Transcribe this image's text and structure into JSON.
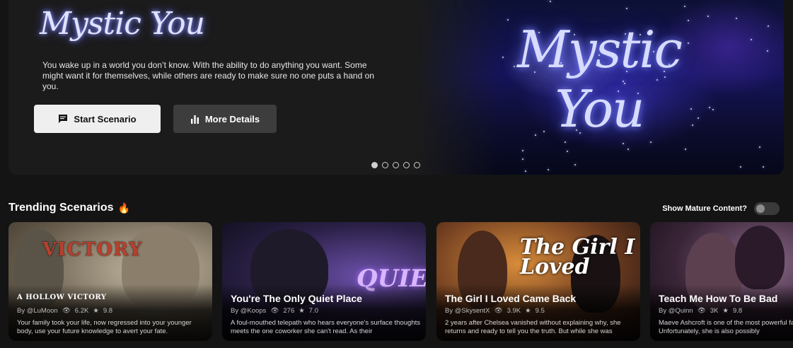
{
  "hero": {
    "logo_text": "Mystic You",
    "art_logo_text": "Mystic You",
    "description": "You wake up in a world you don’t know. With the ability to do anything you want. Some might want it for themselves, while others are ready to make sure no one puts a hand on you.",
    "start_label": "Start Scenario",
    "more_label": "More Details",
    "slides_total": 5,
    "active_slide": 1
  },
  "trending": {
    "title": "Trending Scenarios",
    "mature_label": "Show Mature Content?",
    "mature_enabled": false,
    "cards": [
      {
        "art_text": "VICTORY",
        "art_caption": "A HOLLOW VICTORY",
        "title": "",
        "author": "By @LuMoon",
        "views": "6.2K",
        "rating": "9.8",
        "description": "Your family took your life, now regressed into your younger body, use your future knowledge to avert your fate."
      },
      {
        "art_text": "QUIET",
        "title": "You're The Only Quiet Place",
        "author": "By @Koops",
        "views": "276",
        "rating": "7.0",
        "description": "A foul-mouthed telepath who hears everyone's surface thoughts meets the one coworker she can't read. As their"
      },
      {
        "art_text": "The Girl I Loved",
        "title": "The Girl I Loved Came Back",
        "author": "By @SkysentX",
        "views": "3.9K",
        "rating": "9.5",
        "description": "2 years after Chelsea vanished without explaining why, she returns and ready to tell you the truth. But while she was"
      },
      {
        "art_text": "",
        "title": "Teach Me How To Be Bad",
        "author": "By @Quinn",
        "views": "3K",
        "rating": "9.8",
        "description": "Maeve Ashcroft is one of the most powerful family. Unfortunately, she is also possibly"
      }
    ]
  }
}
